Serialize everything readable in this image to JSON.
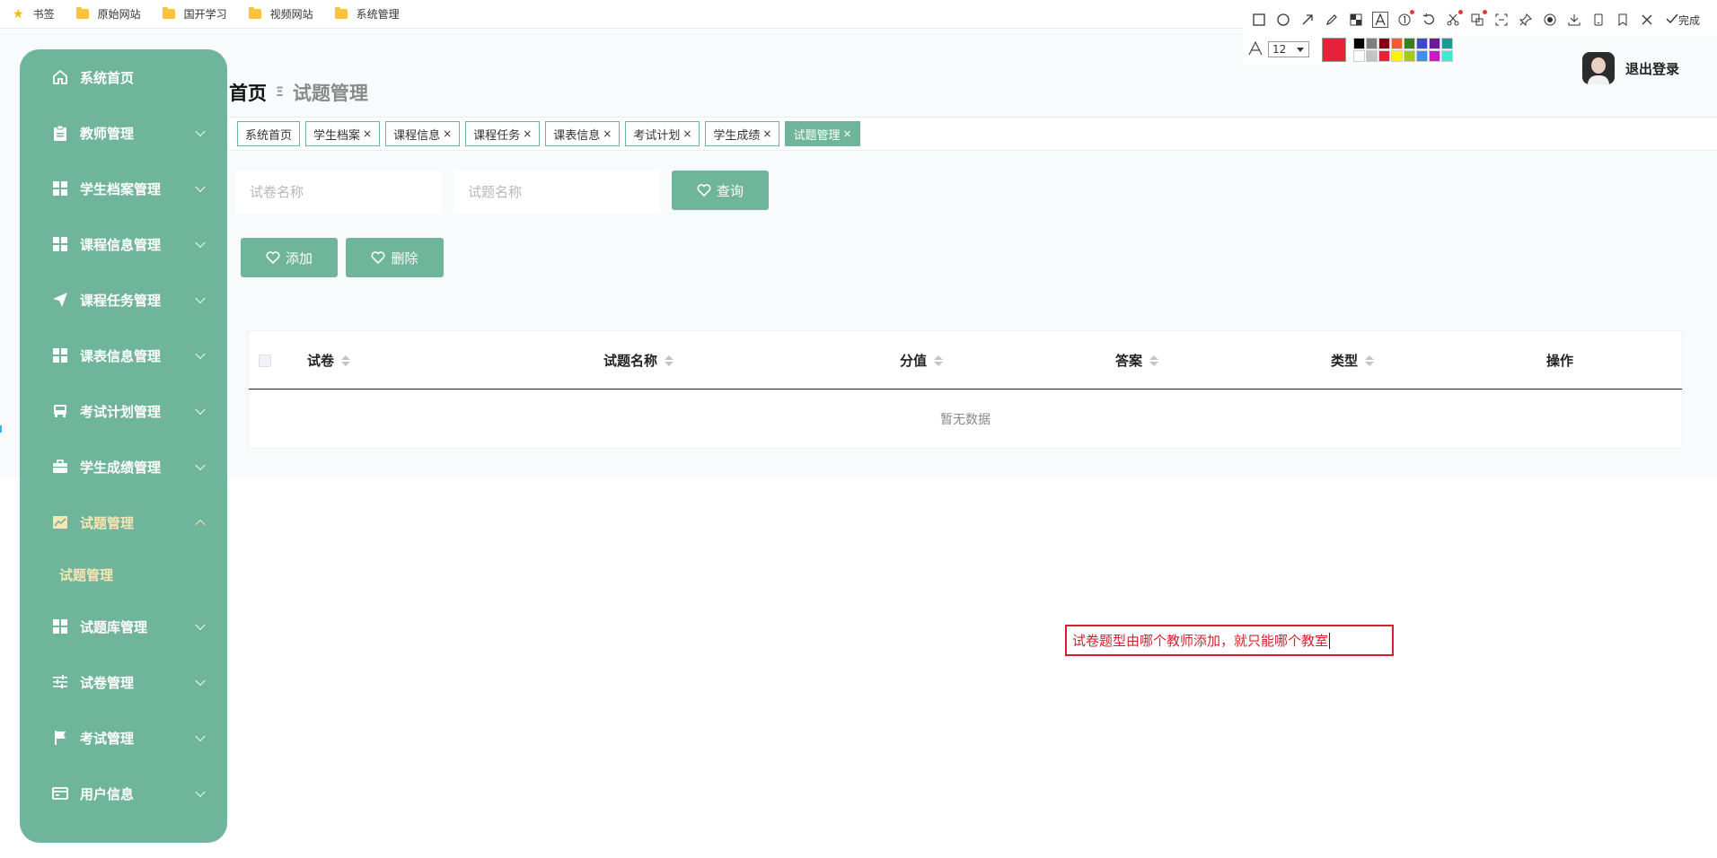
{
  "bookmarks": [
    {
      "label": "书签",
      "icon": "star-icon"
    },
    {
      "label": "原始网站",
      "icon": "folder-icon"
    },
    {
      "label": "国开学习",
      "icon": "folder-icon"
    },
    {
      "label": "视频网站",
      "icon": "folder-icon"
    },
    {
      "label": "系统管理",
      "icon": "folder-icon"
    }
  ],
  "sidebar": {
    "items": [
      {
        "label": "系统首页",
        "icon": "home-icon"
      },
      {
        "label": "教师管理",
        "icon": "clipboard-icon"
      },
      {
        "label": "学生档案管理",
        "icon": "grid-icon"
      },
      {
        "label": "课程信息管理",
        "icon": "grid-icon"
      },
      {
        "label": "课程任务管理",
        "icon": "send-icon"
      },
      {
        "label": "课表信息管理",
        "icon": "grid-icon"
      },
      {
        "label": "考试计划管理",
        "icon": "bus-icon"
      },
      {
        "label": "学生成绩管理",
        "icon": "briefcase-icon"
      },
      {
        "label": "试题管理",
        "icon": "chart-icon"
      },
      {
        "label": "试题管理"
      },
      {
        "label": "试题库管理",
        "icon": "grid-icon"
      },
      {
        "label": "试卷管理",
        "icon": "sliders-icon"
      },
      {
        "label": "考试管理",
        "icon": "flag-icon"
      },
      {
        "label": "用户信息",
        "icon": "card-icon"
      }
    ]
  },
  "header": {
    "home": "首页",
    "separator": "Ξ",
    "current": "试题管理",
    "logout": "退出登录"
  },
  "tabs": [
    {
      "label": "系统首页",
      "close": ""
    },
    {
      "label": "学生档案",
      "close": "×"
    },
    {
      "label": "课程信息",
      "close": "×"
    },
    {
      "label": "课程任务",
      "close": "×"
    },
    {
      "label": "课表信息",
      "close": "×"
    },
    {
      "label": "考试计划",
      "close": "×"
    },
    {
      "label": "学生成绩",
      "close": "×"
    },
    {
      "label": "试题管理",
      "close": "×"
    }
  ],
  "search": {
    "paper_placeholder": "试卷名称",
    "question_placeholder": "试题名称",
    "query_label": "查询"
  },
  "actions": {
    "add_label": "添加",
    "delete_label": "删除"
  },
  "table": {
    "columns": [
      "试卷",
      "试题名称",
      "分值",
      "答案",
      "类型",
      "操作"
    ],
    "empty_text": "暂无数据"
  },
  "annotation": {
    "text": "试卷题型由哪个教师添加，就只能哪个教室"
  },
  "screenshot_toolbar": {
    "done_label": "完成",
    "font_size": "12",
    "current_color": "#e8213b",
    "palette": [
      "#000000",
      "#7f7f7f",
      "#880015",
      "#f25c30",
      "#3a7d22",
      "#3f48cc",
      "#6b1a9b",
      "#1a9b8f",
      "#ffffff",
      "#c3c3c3",
      "#e8213b",
      "#fff200",
      "#a8c81a",
      "#3f8fe8",
      "#c81ac8",
      "#3fe8d0"
    ]
  },
  "colors": {
    "accent": "#6fb59b",
    "active_text": "#f6e6b4",
    "annotation": "#d6202f"
  }
}
